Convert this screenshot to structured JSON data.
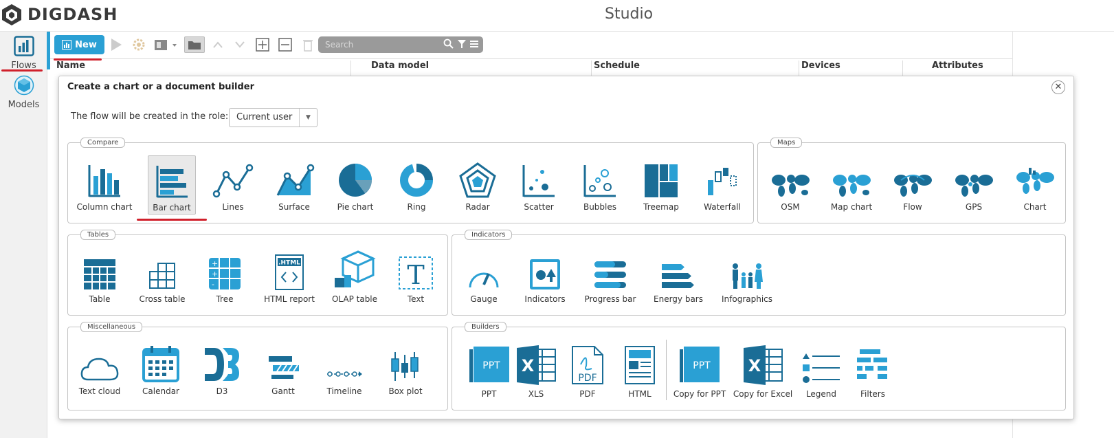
{
  "app": {
    "brand": "DIGDASH",
    "title": "Studio"
  },
  "sidebar": {
    "items": [
      {
        "label": "Flows"
      },
      {
        "label": "Models"
      }
    ]
  },
  "toolbar": {
    "new_label": "New",
    "search_placeholder": "Search"
  },
  "table": {
    "columns": [
      "Name",
      "Data model",
      "Schedule",
      "Devices",
      "Attributes"
    ]
  },
  "dialog": {
    "title": "Create a chart or a document builder",
    "role_label": "The flow will be created in the role:",
    "role_value": "Current user",
    "groups": {
      "compare": {
        "title": "Compare",
        "items": [
          "Column chart",
          "Bar chart",
          "Lines",
          "Surface",
          "Pie chart",
          "Ring",
          "Radar",
          "Scatter",
          "Bubbles",
          "Treemap",
          "Waterfall"
        ]
      },
      "maps": {
        "title": "Maps",
        "items": [
          "OSM",
          "Map chart",
          "Flow",
          "GPS",
          "Chart"
        ]
      },
      "tables": {
        "title": "Tables",
        "items": [
          "Table",
          "Cross table",
          "Tree",
          "HTML report",
          "OLAP table",
          "Text"
        ]
      },
      "indicators": {
        "title": "Indicators",
        "items": [
          "Gauge",
          "Indicators",
          "Progress bar",
          "Energy bars",
          "Infographics"
        ]
      },
      "misc": {
        "title": "Miscellaneous",
        "items": [
          "Text cloud",
          "Calendar",
          "D3",
          "Gantt",
          "Timeline",
          "Box plot"
        ]
      },
      "builders": {
        "title": "Builders",
        "items": [
          "PPT",
          "XLS",
          "PDF",
          "HTML",
          "Copy for PPT",
          "Copy for Excel",
          "Legend",
          "Filters"
        ]
      }
    },
    "icon_text": {
      "html": ".HTML",
      "ppt": "PPT",
      "x": "X",
      "pdf": "PDF",
      "t": "T"
    }
  },
  "colors": {
    "accent": "#2aa0d4",
    "icon_dark": "#1a6d96",
    "highlight": "#d0202b"
  }
}
